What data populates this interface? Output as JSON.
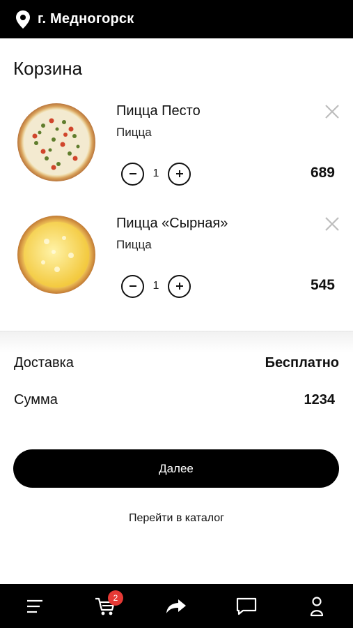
{
  "header": {
    "location_icon": "map-pin-icon",
    "city": "г. Медногорск"
  },
  "cart": {
    "title": "Корзина",
    "items": [
      {
        "name": "Пицца Песто",
        "category": "Пицца",
        "quantity": "1",
        "price": "689",
        "image": "pizza-pesto-image"
      },
      {
        "name": "Пицца «Сырная»",
        "category": "Пицца",
        "quantity": "1",
        "price": "545",
        "image": "pizza-cheese-image"
      }
    ]
  },
  "summary": {
    "delivery_label": "Доставка",
    "delivery_value": "Бесплатно",
    "sum_label": "Сумма",
    "sum_value": "1234"
  },
  "actions": {
    "next_label": "Далее",
    "catalog_label": "Перейти в каталог"
  },
  "bottom_nav": {
    "items": [
      "menu-icon",
      "cart-icon",
      "share-icon",
      "chat-icon",
      "profile-icon"
    ],
    "cart_badge": "2"
  },
  "colors": {
    "bar": "#000000",
    "badge": "#e53935",
    "background": "#ffffff"
  }
}
